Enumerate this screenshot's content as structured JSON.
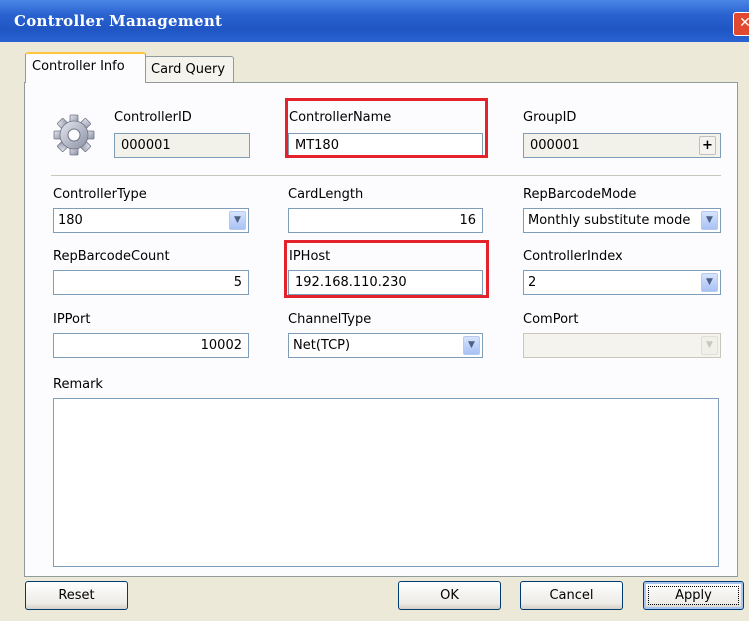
{
  "window": {
    "title": "Controller Management",
    "close_glyph": "✕"
  },
  "tabs": [
    {
      "label": "Controller Info",
      "active": true
    },
    {
      "label": "Card Query",
      "active": false
    }
  ],
  "fields": {
    "controller_id": {
      "label": "ControllerID",
      "value": "000001"
    },
    "controller_name": {
      "label": "ControllerName",
      "value": "MT180"
    },
    "group_id": {
      "label": "GroupID",
      "value": "000001",
      "button": "+"
    },
    "controller_type": {
      "label": "ControllerType",
      "value": "180"
    },
    "card_length": {
      "label": "CardLength",
      "value": "16"
    },
    "rep_barcode_mode": {
      "label": "RepBarcodeMode",
      "value": "Monthly substitute mode"
    },
    "rep_barcode_count": {
      "label": "RepBarcodeCount",
      "value": "5"
    },
    "ip_host": {
      "label": "IPHost",
      "value": "192.168.110.230"
    },
    "controller_index": {
      "label": "ControllerIndex",
      "value": "2"
    },
    "ip_port": {
      "label": "IPPort",
      "value": "10002"
    },
    "channel_type": {
      "label": "ChannelType",
      "value": "Net(TCP)"
    },
    "com_port": {
      "label": "ComPort",
      "value": ""
    },
    "remark": {
      "label": "Remark",
      "value": ""
    }
  },
  "buttons": {
    "reset": "Reset",
    "ok": "OK",
    "cancel": "Cancel",
    "apply": "Apply"
  },
  "icons": {
    "header": "gear-icon",
    "dropdown": "▼"
  },
  "colors": {
    "titlebar": "#2a62d0",
    "dialog_bg": "#ece9d8",
    "highlight": "#e4222b",
    "active_tab_accent": "#ffc83c"
  },
  "highlighted_fields": [
    "ControllerName",
    "IPHost"
  ]
}
